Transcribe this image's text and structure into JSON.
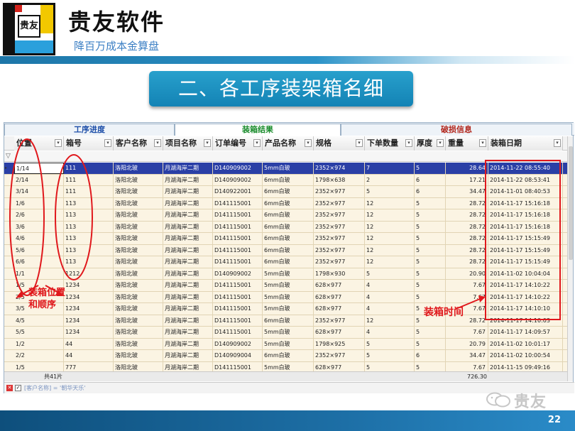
{
  "header": {
    "logo_glyph": "贵友",
    "brand_name": "贵友软件",
    "slogan": "降百万成本金算盘"
  },
  "section_title": "二、各工序装架箱名细",
  "tabs": [
    "工序进度",
    "装箱结果",
    "破损信息"
  ],
  "columns": [
    "位置",
    "箱号",
    "客户名称",
    "项目名称",
    "订单编号",
    "产品名称",
    "规格",
    "下单数量",
    "厚度",
    "重量",
    "装箱日期"
  ],
  "rows": [
    [
      "1/14",
      "111",
      "洛阳北玻",
      "月湖海岸二期",
      "D140909002",
      "5mm白玻",
      "2352×974",
      "7",
      "5",
      "28.64",
      "2014-11-22 08:55:40"
    ],
    [
      "2/14",
      "111",
      "洛阳北玻",
      "月湖海岸二期",
      "D140909002",
      "6mm白玻",
      "1798×638",
      "2",
      "6",
      "17.21",
      "2014-11-22 08:53:41"
    ],
    [
      "3/14",
      "111",
      "洛阳北玻",
      "月湖海岸二期",
      "D140922001",
      "6mm白玻",
      "2352×977",
      "5",
      "6",
      "34.47",
      "2014-11-01 08:40:53"
    ],
    [
      "1/6",
      "113",
      "洛阳北玻",
      "月湖海岸二期",
      "D141115001",
      "6mm白玻",
      "2352×977",
      "12",
      "5",
      "28.72",
      "2014-11-17 15:16:18"
    ],
    [
      "2/6",
      "113",
      "洛阳北玻",
      "月湖海岸二期",
      "D141115001",
      "6mm白玻",
      "2352×977",
      "12",
      "5",
      "28.72",
      "2014-11-17 15:16:18"
    ],
    [
      "3/6",
      "113",
      "洛阳北玻",
      "月湖海岸二期",
      "D141115001",
      "6mm白玻",
      "2352×977",
      "12",
      "5",
      "28.72",
      "2014-11-17 15:16:18"
    ],
    [
      "4/6",
      "113",
      "洛阳北玻",
      "月湖海岸二期",
      "D141115001",
      "6mm白玻",
      "2352×977",
      "12",
      "5",
      "28.72",
      "2014-11-17 15:15:49"
    ],
    [
      "5/6",
      "113",
      "洛阳北玻",
      "月湖海岸二期",
      "D141115001",
      "6mm白玻",
      "2352×977",
      "12",
      "5",
      "28.72",
      "2014-11-17 15:15:49"
    ],
    [
      "6/6",
      "113",
      "洛阳北玻",
      "月湖海岸二期",
      "D141115001",
      "6mm白玻",
      "2352×977",
      "12",
      "5",
      "28.72",
      "2014-11-17 15:15:49"
    ],
    [
      "1/1",
      "1212",
      "洛阳北玻",
      "月湖海岸二期",
      "D140909002",
      "5mm白玻",
      "1798×930",
      "5",
      "5",
      "20.90",
      "2014-11-02 10:04:04"
    ],
    [
      "1/5",
      "1234",
      "洛阳北玻",
      "月湖海岸二期",
      "D141115001",
      "5mm白玻",
      "628×977",
      "4",
      "5",
      "7.67",
      "2014-11-17 14:10:22"
    ],
    [
      "2/5",
      "1234",
      "洛阳北玻",
      "月湖海岸二期",
      "D141115001",
      "5mm白玻",
      "628×977",
      "4",
      "5",
      "7.67",
      "2014-11-17 14:10:22"
    ],
    [
      "3/5",
      "1234",
      "洛阳北玻",
      "月湖海岸二期",
      "D141115001",
      "5mm白玻",
      "628×977",
      "4",
      "5",
      "7.67",
      "2014-11-17 14:10:10"
    ],
    [
      "4/5",
      "1234",
      "洛阳北玻",
      "月湖海岸二期",
      "D141115001",
      "6mm白玻",
      "2352×977",
      "12",
      "5",
      "28.72",
      "2014-11-17 14:10:03"
    ],
    [
      "5/5",
      "1234",
      "洛阳北玻",
      "月湖海岸二期",
      "D141115001",
      "5mm白玻",
      "628×977",
      "4",
      "5",
      "7.67",
      "2014-11-17 14:09:57"
    ],
    [
      "1/2",
      "44",
      "洛阳北玻",
      "月湖海岸二期",
      "D140909002",
      "5mm白玻",
      "1798×925",
      "5",
      "5",
      "20.79",
      "2014-11-02 10:01:17"
    ],
    [
      "2/2",
      "44",
      "洛阳北玻",
      "月湖海岸二期",
      "D140909004",
      "6mm白玻",
      "2352×977",
      "5",
      "6",
      "34.47",
      "2014-11-02 10:00:54"
    ],
    [
      "1/5",
      "777",
      "洛阳北玻",
      "月湖海岸二期",
      "D141115001",
      "5mm白玻",
      "628×977",
      "5",
      "5",
      "7.67",
      "2014-11-15 09:49:16"
    ]
  ],
  "footer": {
    "count": "共41片",
    "total_weight": "726.30"
  },
  "status_bar": {
    "filter_text": "[客户名称] = '朝华天乐'"
  },
  "annotations": {
    "left_label_line1": "装箱位置",
    "left_label_line2": "和顺序",
    "right_label": "装箱时间"
  },
  "watermark": "贵友",
  "page_number": "22",
  "colors": {
    "annotation_red": "#e0181c",
    "selected_row": "#2a3fa6",
    "title_blue": "#1a8fc2",
    "row_bg": "#fbf4e3"
  }
}
